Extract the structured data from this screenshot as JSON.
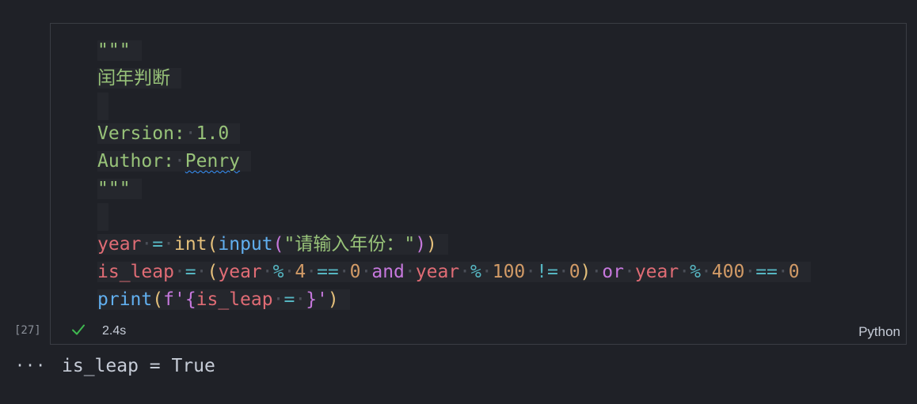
{
  "cell": {
    "execution_count": "[27]",
    "status_time": "2.4s",
    "language": "Python",
    "code_lines": [
      "\"\"\"",
      "闰年判断",
      "",
      "Version: 1.0",
      "Author: Penry",
      "\"\"\"",
      "",
      "year = int(input(\"请输入年份：\"))",
      "is_leap = (year % 4 == 0 and year % 100 != 0) or year % 400 == 0",
      "print(f'{is_leap = }')"
    ],
    "tokens": {
      "doc_quote_open": "\"\"\"",
      "doc_title": "闰年判断",
      "doc_version_label": "Version:",
      "doc_version_value": "1.0",
      "doc_author_label": "Author:",
      "doc_author_value": "Penry",
      "doc_quote_close": "\"\"\"",
      "var_year": "year",
      "fn_int": "int",
      "fn_input": "input",
      "prompt_string": "\"请输入年份：\"",
      "var_is_leap": "is_leap",
      "num_4": "4",
      "num_0": "0",
      "num_100": "100",
      "num_400": "400",
      "kw_and": "and",
      "kw_or": "or",
      "fn_print": "print",
      "fstring_prefix": "f'",
      "fstring_close": "'"
    }
  },
  "output": {
    "more_icon": "ellipsis-icon",
    "text": "is_leap = True"
  },
  "icons": {
    "status": "check-icon"
  },
  "colors": {
    "background": "#1f2127",
    "string": "#98c379",
    "keyword": "#c678dd",
    "variable": "#e06c75",
    "operator": "#56b6c2",
    "number": "#d19a66",
    "function": "#61afef",
    "success": "#3fb950"
  }
}
